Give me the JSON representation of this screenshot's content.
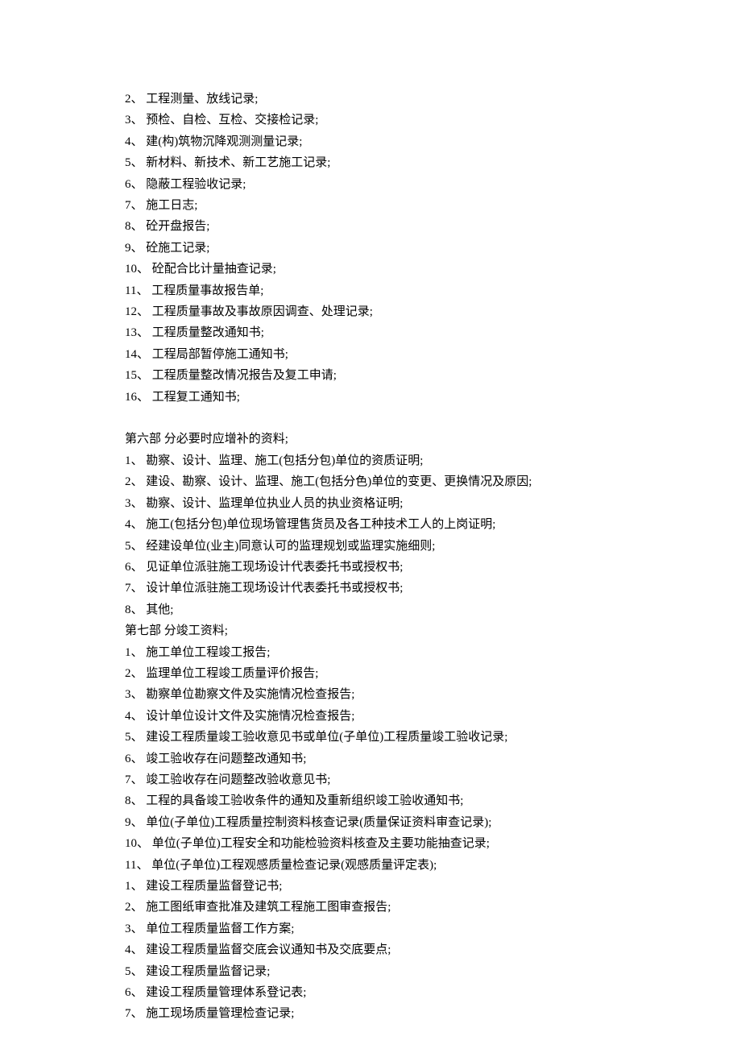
{
  "blocks": [
    {
      "items": [
        "2、 工程测量、放线记录;",
        "3、 预检、自检、互检、交接检记录;",
        "4、 建(构)筑物沉降观测测量记录;",
        "5、 新材料、新技术、新工艺施工记录;",
        "6、 隐蔽工程验收记录;",
        "7、 施工日志;",
        "8、 砼开盘报告;",
        "9、 砼施工记录;",
        "10、 砼配合比计量抽查记录;",
        "11、 工程质量事故报告单;",
        "12、 工程质量事故及事故原因调查、处理记录;",
        "13、 工程质量整改通知书;",
        "14、 工程局部暂停施工通知书;",
        "15、 工程质量整改情况报告及复工申请;",
        "16、 工程复工通知书;"
      ]
    },
    {
      "blank": true
    },
    {
      "items": [
        "第六部 分必要时应增补的资料;",
        "1、 勘察、设计、监理、施工(包括分包)单位的资质证明;",
        "2、 建设、勘察、设计、监理、施工(包括分色)单位的变更、更换情况及原因;",
        "3、 勘察、设计、监理单位执业人员的执业资格证明;",
        "4、 施工(包括分包)单位现场管理售货员及各工种技术工人的上岗证明;",
        "5、 经建设单位(业主)同意认可的监理规划或监理实施细则;",
        "6、 见证单位派驻施工现场设计代表委托书或授权书;",
        "7、 设计单位派驻施工现场设计代表委托书或授权书;",
        "8、 其他;",
        "第七部 分竣工资料;",
        "1、 施工单位工程竣工报告;",
        "2、 监理单位工程竣工质量评价报告;",
        "3、 勘察单位勘察文件及实施情况检查报告;",
        "4、 设计单位设计文件及实施情况检查报告;",
        "5、 建设工程质量竣工验收意见书或单位(子单位)工程质量竣工验收记录;",
        "6、 竣工验收存在问题整改通知书;",
        "7、 竣工验收存在问题整改验收意见书;",
        "8、 工程的具备竣工验收条件的通知及重新组织竣工验收通知书;",
        "9、 单位(子单位)工程质量控制资料核查记录(质量保证资料审查记录);",
        "10、 单位(子单位)工程安全和功能检验资料核查及主要功能抽查记录;",
        "11、 单位(子单位)工程观感质量检查记录(观感质量评定表);",
        "1、 建设工程质量监督登记书;",
        "2、 施工图纸审查批准及建筑工程施工图审查报告;",
        "3、 单位工程质量监督工作方案;",
        "4、 建设工程质量监督交底会议通知书及交底要点;",
        "5、 建设工程质量监督记录;",
        "6、 建设工程质量管理体系登记表;",
        "7、 施工现场质量管理检查记录;"
      ]
    }
  ]
}
